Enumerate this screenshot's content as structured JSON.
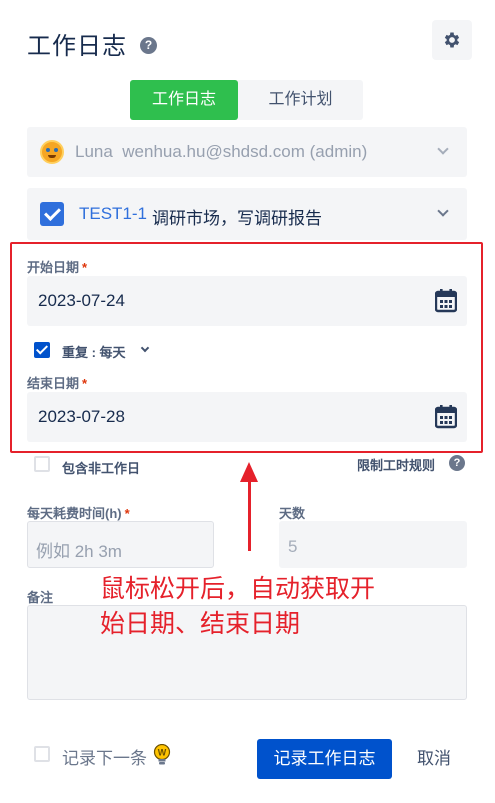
{
  "header": {
    "title": "工作日志",
    "help_icon": "question-circle-icon",
    "settings_icon": "gear-icon"
  },
  "tabs": [
    {
      "label": "工作日志",
      "active": true
    },
    {
      "label": "工作计划",
      "active": false
    }
  ],
  "user": {
    "name": "Luna",
    "email": "wenhua.hu@shdsd.com (admin)"
  },
  "task": {
    "checked": true,
    "key": "TEST1-1",
    "summary": "调研市场，写调研报告"
  },
  "start_date": {
    "label": "开始日期",
    "required_mark": "*",
    "value": "2023-07-24"
  },
  "repeat": {
    "checked": true,
    "label": "重复 : 每天"
  },
  "end_date": {
    "label": "结束日期",
    "required_mark": "*",
    "value": "2023-07-28"
  },
  "include_non_workday": {
    "checked": false,
    "label": "包含非工作日"
  },
  "limit_rule_label": "限制工时规则",
  "daily_time": {
    "label": "每天耗费时间(h)",
    "required_mark": "*",
    "placeholder": "例如 2h 3m"
  },
  "days": {
    "label": "天数",
    "value": "5"
  },
  "note": {
    "label": "备注"
  },
  "annotation": {
    "line1": "鼠标松开后，自动获取开",
    "line2": "始日期、结束日期",
    "color": "#e5212b"
  },
  "footer": {
    "next_label": "记录下一条",
    "submit_label": "记录工作日志",
    "cancel_label": "取消"
  },
  "colors": {
    "tab_active": "#2fbf4e",
    "primary": "#0052cc",
    "link": "#2f6fdc"
  }
}
